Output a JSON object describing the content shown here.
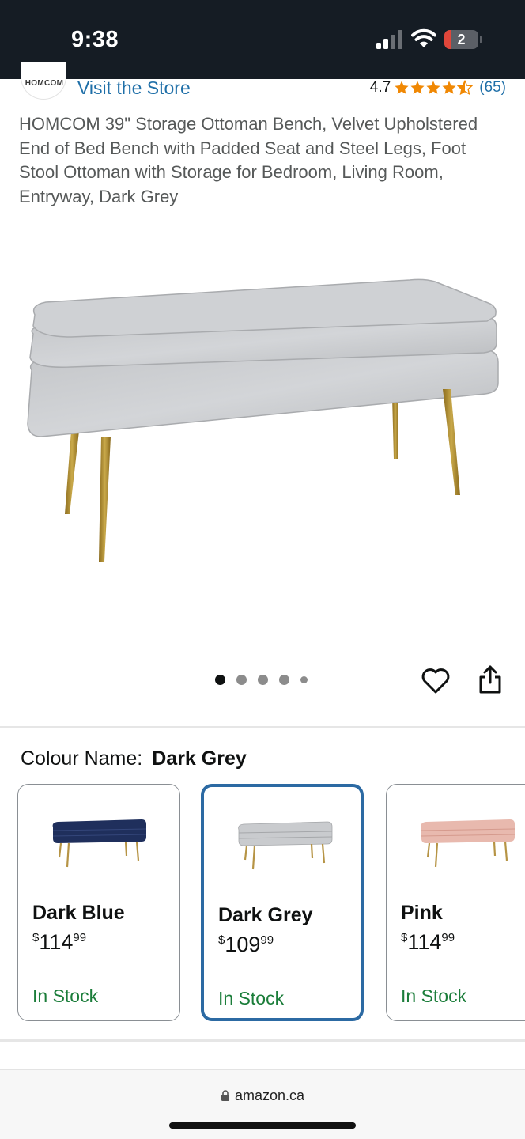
{
  "status_bar": {
    "time": "9:38",
    "battery_level": "2",
    "icons": [
      "signal-icon",
      "wifi-icon",
      "battery-icon"
    ]
  },
  "store": {
    "logo_text": "HOMCOM",
    "visit_label": "Visit the Store"
  },
  "rating": {
    "value": "4.7",
    "stars": 4.5,
    "count": "(65)",
    "star_color": "#f08804"
  },
  "product": {
    "title": "HOMCOM 39\" Storage Ottoman Bench, Velvet Upholstered End of Bed Bench with Padded Seat and Steel Legs, Foot Stool Ottoman with Storage for Bedroom, Living Room, Entryway, Dark Grey"
  },
  "gallery": {
    "image_count": 5,
    "active_index": 0
  },
  "actions": {
    "icons": [
      "heart-icon",
      "share-icon"
    ]
  },
  "colour": {
    "label": "Colour Name:",
    "selected": "Dark Grey",
    "options": [
      {
        "name": "Dark Blue",
        "price_currency": "$",
        "price_whole": "114",
        "price_fraction": "99",
        "stock": "In Stock",
        "color": "#1f2f5c"
      },
      {
        "name": "Dark Grey",
        "price_currency": "$",
        "price_whole": "109",
        "price_fraction": "99",
        "stock": "In Stock",
        "color": "#c9cbce"
      },
      {
        "name": "Pink",
        "price_currency": "$",
        "price_whole": "114",
        "price_fraction": "99",
        "stock": "In Stock",
        "color": "#e8b9ae"
      }
    ]
  },
  "browser": {
    "url": "amazon.ca"
  },
  "colors": {
    "link": "#1f6fa8",
    "in_stock": "#1b7d3a",
    "selected_border": "#2c6aa3",
    "status_bar_bg": "#151c24"
  }
}
